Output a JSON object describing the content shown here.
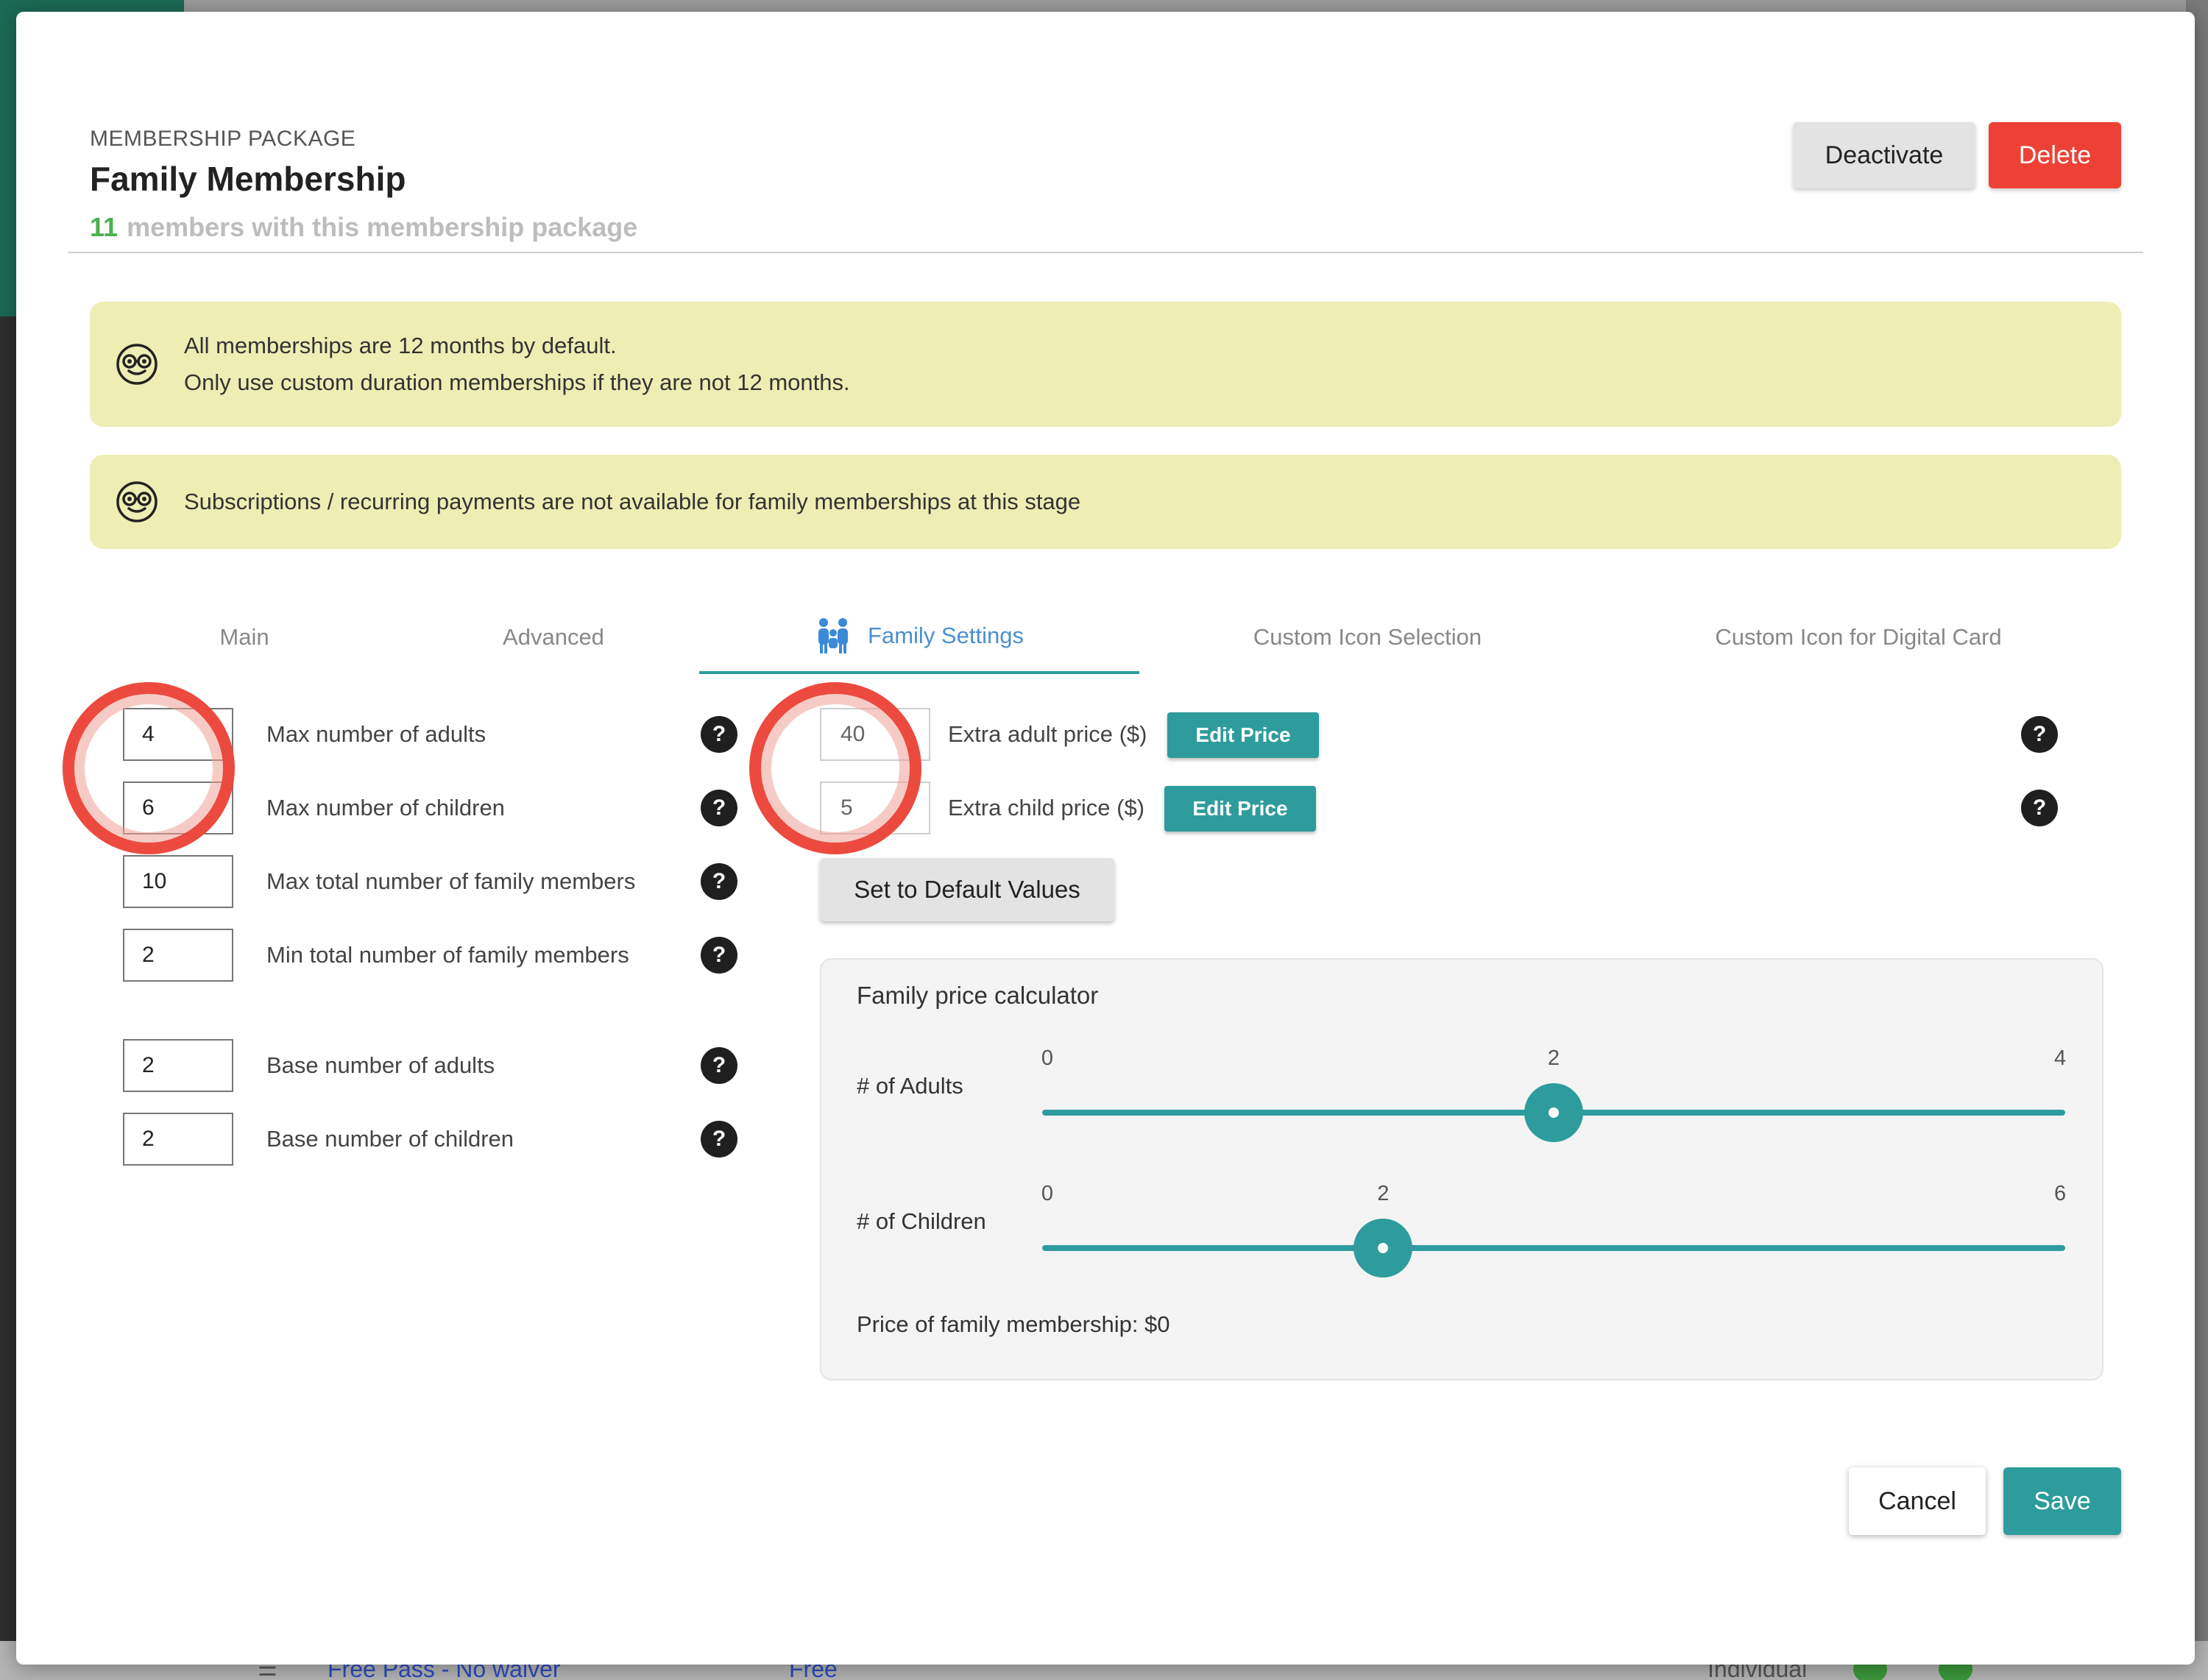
{
  "background": {
    "row_link": "Free Pass - No waiver",
    "row_price": "Free",
    "row_type": "Individual"
  },
  "header": {
    "eyebrow": "MEMBERSHIP PACKAGE",
    "title": "Family Membership",
    "member_count": "11",
    "member_text": "members with this membership package",
    "deactivate_label": "Deactivate",
    "delete_label": "Delete"
  },
  "notices": {
    "duration_line1": "All memberships are 12 months by default.",
    "duration_line2": "Only use custom duration memberships if they are not 12 months.",
    "subscriptions": "Subscriptions / recurring payments are not available for family memberships at this stage",
    "icon": "nerd-face-icon"
  },
  "tabs": {
    "main": "Main",
    "advanced": "Advanced",
    "family": "Family Settings",
    "custom_icon": "Custom Icon Selection",
    "digital_card": "Custom Icon for Digital Card",
    "active": "family"
  },
  "family_fields": {
    "max_adults": {
      "value": "4",
      "label": "Max number of adults"
    },
    "max_children": {
      "value": "6",
      "label": "Max number of children"
    },
    "max_total": {
      "value": "10",
      "label": "Max total number of family members"
    },
    "min_total": {
      "value": "2",
      "label": "Min total number of family members"
    },
    "base_adults": {
      "value": "2",
      "label": "Base number of adults"
    },
    "base_children": {
      "value": "2",
      "label": "Base number of children"
    }
  },
  "pricing": {
    "extra_adult": {
      "value": "40",
      "label": "Extra adult price ($)"
    },
    "extra_child": {
      "value": "5",
      "label": "Extra child price ($)"
    },
    "edit_label": "Edit Price",
    "default_label": "Set to Default Values"
  },
  "calculator": {
    "title": "Family price calculator",
    "adults": {
      "label": "# of Adults",
      "min": 0,
      "max": 4,
      "value": 2,
      "min_label": "0",
      "max_label": "4",
      "value_label": "2"
    },
    "children": {
      "label": "# of Children",
      "min": 0,
      "max": 6,
      "value": 2,
      "min_label": "0",
      "max_label": "6",
      "value_label": "2"
    },
    "price_text": "Price of family membership: $0"
  },
  "footer": {
    "cancel_label": "Cancel",
    "save_label": "Save"
  },
  "colors": {
    "accent": "#2e9c9c",
    "danger": "#ee4136",
    "success": "#4caf50",
    "notice_bg": "#eeedb4",
    "annotation": "#ec4a3f"
  }
}
